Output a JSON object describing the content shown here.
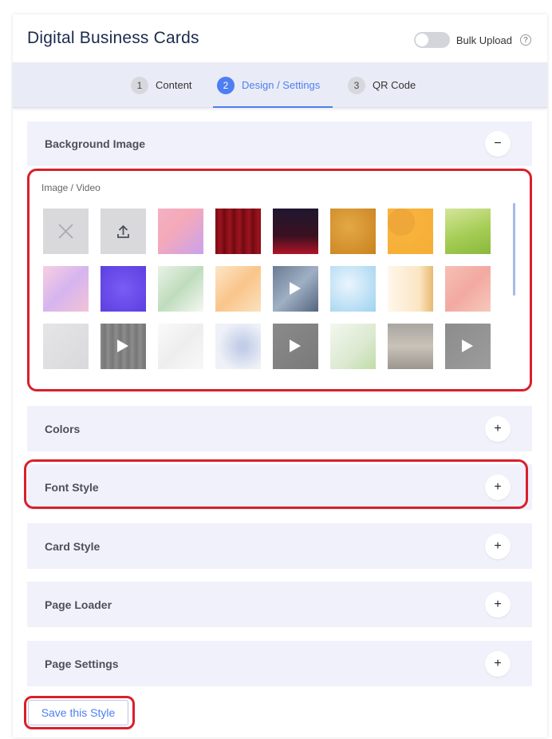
{
  "header": {
    "title": "Digital Business Cards",
    "bulk_upload_label": "Bulk Upload",
    "help_glyph": "?"
  },
  "steps": [
    {
      "number": "1",
      "label": "Content",
      "active": false
    },
    {
      "number": "2",
      "label": "Design / Settings",
      "active": true
    },
    {
      "number": "3",
      "label": "QR Code",
      "active": false
    }
  ],
  "background_image": {
    "title": "Background Image",
    "toggle_glyph": "−",
    "media_label": "Image / Video"
  },
  "tiles": [
    {
      "kind": "none",
      "icon": "close-icon",
      "video": false
    },
    {
      "kind": "upload",
      "icon": "upload-icon",
      "video": false
    },
    {
      "kind": "image",
      "style": "linear-gradient(135deg,#f3b1c4 0%,#f5a9b8 40%,#c9a2ee 100%)",
      "video": false
    },
    {
      "kind": "image",
      "style": "repeating-linear-gradient(90deg,#7c0b12 0px,#9c1420 6px,#6a0a0f 12px)",
      "video": false
    },
    {
      "kind": "image",
      "style": "linear-gradient(180deg,#1f1730 0%,#3a1020 60%,#b01428 100%)",
      "video": false
    },
    {
      "kind": "image",
      "style": "radial-gradient(circle at 40% 40%,#e3a846,#c9831e)",
      "video": false
    },
    {
      "kind": "image",
      "style": "radial-gradient(circle at 30% 30%,#f0a73a 30%,#f7b33d 31%,#f6ad34 100%)",
      "video": false
    },
    {
      "kind": "image",
      "style": "linear-gradient(160deg,#d5e59a 0%,#a5cd55 55%,#8ab83c 100%)",
      "video": false
    },
    {
      "kind": "image",
      "style": "linear-gradient(135deg,#f7cfe0 0%,#d6b4ef 50%,#f2c3d6 100%)",
      "video": false
    },
    {
      "kind": "image",
      "style": "radial-gradient(circle at 50% 50%,#7a5cf4,#5b3fe0)",
      "video": false
    },
    {
      "kind": "image",
      "style": "linear-gradient(135deg,#e8f3e6 0%,#bfdcbd 50%,#f4f8f1 100%)",
      "video": false
    },
    {
      "kind": "image",
      "style": "linear-gradient(135deg,#fde6c8 0%,#f9c58a 50%,#fbe1bd 100%)",
      "video": false
    },
    {
      "kind": "image",
      "style": "linear-gradient(135deg,#6a7b93 0%,#9fb0c4 50%,#55657e 100%)",
      "video": true
    },
    {
      "kind": "image",
      "style": "radial-gradient(circle at 40% 40%,#eaf5fd,#9fd2f0)",
      "video": false
    },
    {
      "kind": "image",
      "style": "linear-gradient(90deg,#fff7ec 0%,#fbe5c3 70%,#e7b96f 100%)",
      "video": false
    },
    {
      "kind": "image",
      "style": "linear-gradient(135deg,#f5c0b6 0%,#f2a9a0 50%,#f7c8bd 100%)",
      "video": false
    },
    {
      "kind": "image",
      "style": "linear-gradient(135deg,#e5e5e7 0%,#d9d9dc 100%)",
      "video": false
    },
    {
      "kind": "image",
      "style": "repeating-linear-gradient(90deg,#8a8a8a 0px,#777 5px,#8f8f8f 10px)",
      "video": true
    },
    {
      "kind": "image",
      "style": "linear-gradient(135deg,#fafafa 0%,#eeeeee 50%,#f8f8f8 100%)",
      "video": false
    },
    {
      "kind": "image",
      "style": "radial-gradient(circle at 60% 50%,#c2cde8 10%,#eef1f7 70%)",
      "video": false
    },
    {
      "kind": "image",
      "style": "linear-gradient(135deg,#8a8a8a 0%,#7a7a7a 100%)",
      "video": true
    },
    {
      "kind": "image",
      "style": "linear-gradient(135deg,#f3f7ef 0%,#dbe9d0 60%,#bfdca8 100%)",
      "video": false
    },
    {
      "kind": "image",
      "style": "linear-gradient(180deg,#a9a5a0 0%,#c9c2b8 50%,#9b968f 100%)",
      "video": false
    },
    {
      "kind": "image",
      "style": "linear-gradient(135deg,#8c8c8c 0%,#9c9c9c 100%)",
      "video": true
    }
  ],
  "sections": [
    {
      "title": "Colors",
      "toggle_glyph": "+"
    },
    {
      "title": "Font Style",
      "toggle_glyph": "+"
    },
    {
      "title": "Card Style",
      "toggle_glyph": "+"
    },
    {
      "title": "Page Loader",
      "toggle_glyph": "+"
    },
    {
      "title": "Page Settings",
      "toggle_glyph": "+"
    }
  ],
  "save_button_label": "Save this Style",
  "colors": {
    "accent": "#4e7ef2",
    "highlight": "#d8202c",
    "section_bg": "#f0f1fb"
  }
}
